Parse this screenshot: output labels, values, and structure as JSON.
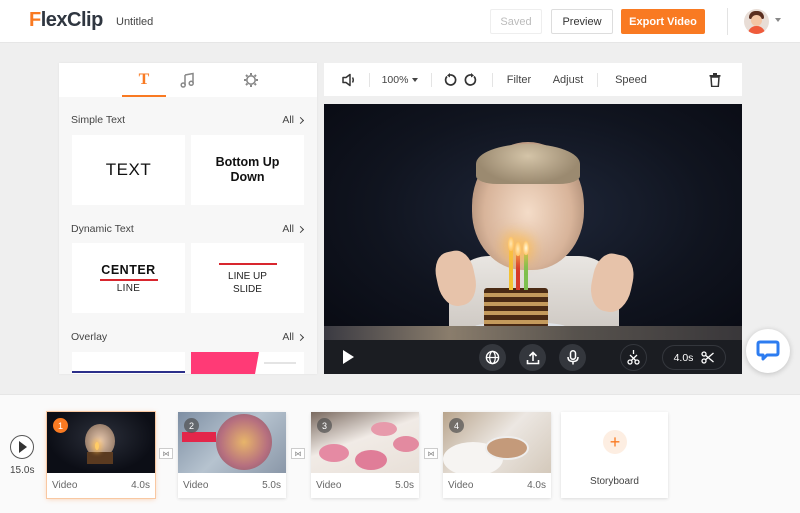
{
  "header": {
    "logo_first": "F",
    "logo_rest": "lexClip",
    "doc_title": "Untitled",
    "saved_label": "Saved",
    "preview_label": "Preview",
    "export_label": "Export Video"
  },
  "left_panel": {
    "tabs": [
      {
        "name": "text",
        "icon": "T",
        "active": true
      },
      {
        "name": "music",
        "icon": "music-note-icon",
        "active": false
      },
      {
        "name": "settings",
        "icon": "gear-icon",
        "active": false
      }
    ],
    "sections": [
      {
        "title": "Simple Text",
        "all_label": "All"
      },
      {
        "title": "Dynamic Text",
        "all_label": "All"
      },
      {
        "title": "Overlay",
        "all_label": "All"
      }
    ],
    "simple_text_cards": [
      "TEXT",
      "Bottom Up Down"
    ],
    "dynamic_text_cards": [
      {
        "main": "CENTER",
        "sub": "LINE"
      },
      {
        "main": "LINE UP",
        "sub": "SLIDE"
      }
    ]
  },
  "toolbar": {
    "zoom": "100%",
    "filter": "Filter",
    "adjust": "Adjust",
    "speed": "Speed"
  },
  "preview": {
    "clip_duration": "4.0s"
  },
  "timeline": {
    "total_duration": "15.0s",
    "clips": [
      {
        "number": "1",
        "label": "Video",
        "duration": "4.0s",
        "selected": true
      },
      {
        "number": "2",
        "label": "Video",
        "duration": "5.0s",
        "selected": false
      },
      {
        "number": "3",
        "label": "Video",
        "duration": "5.0s",
        "selected": false
      },
      {
        "number": "4",
        "label": "Video",
        "duration": "4.0s",
        "selected": false
      }
    ],
    "storyboard_label": "Storyboard"
  },
  "colors": {
    "accent": "#f97a22",
    "chat": "#2d7cf0",
    "red_line": "#d8262e",
    "overlay_pink": "#ff3a76"
  }
}
